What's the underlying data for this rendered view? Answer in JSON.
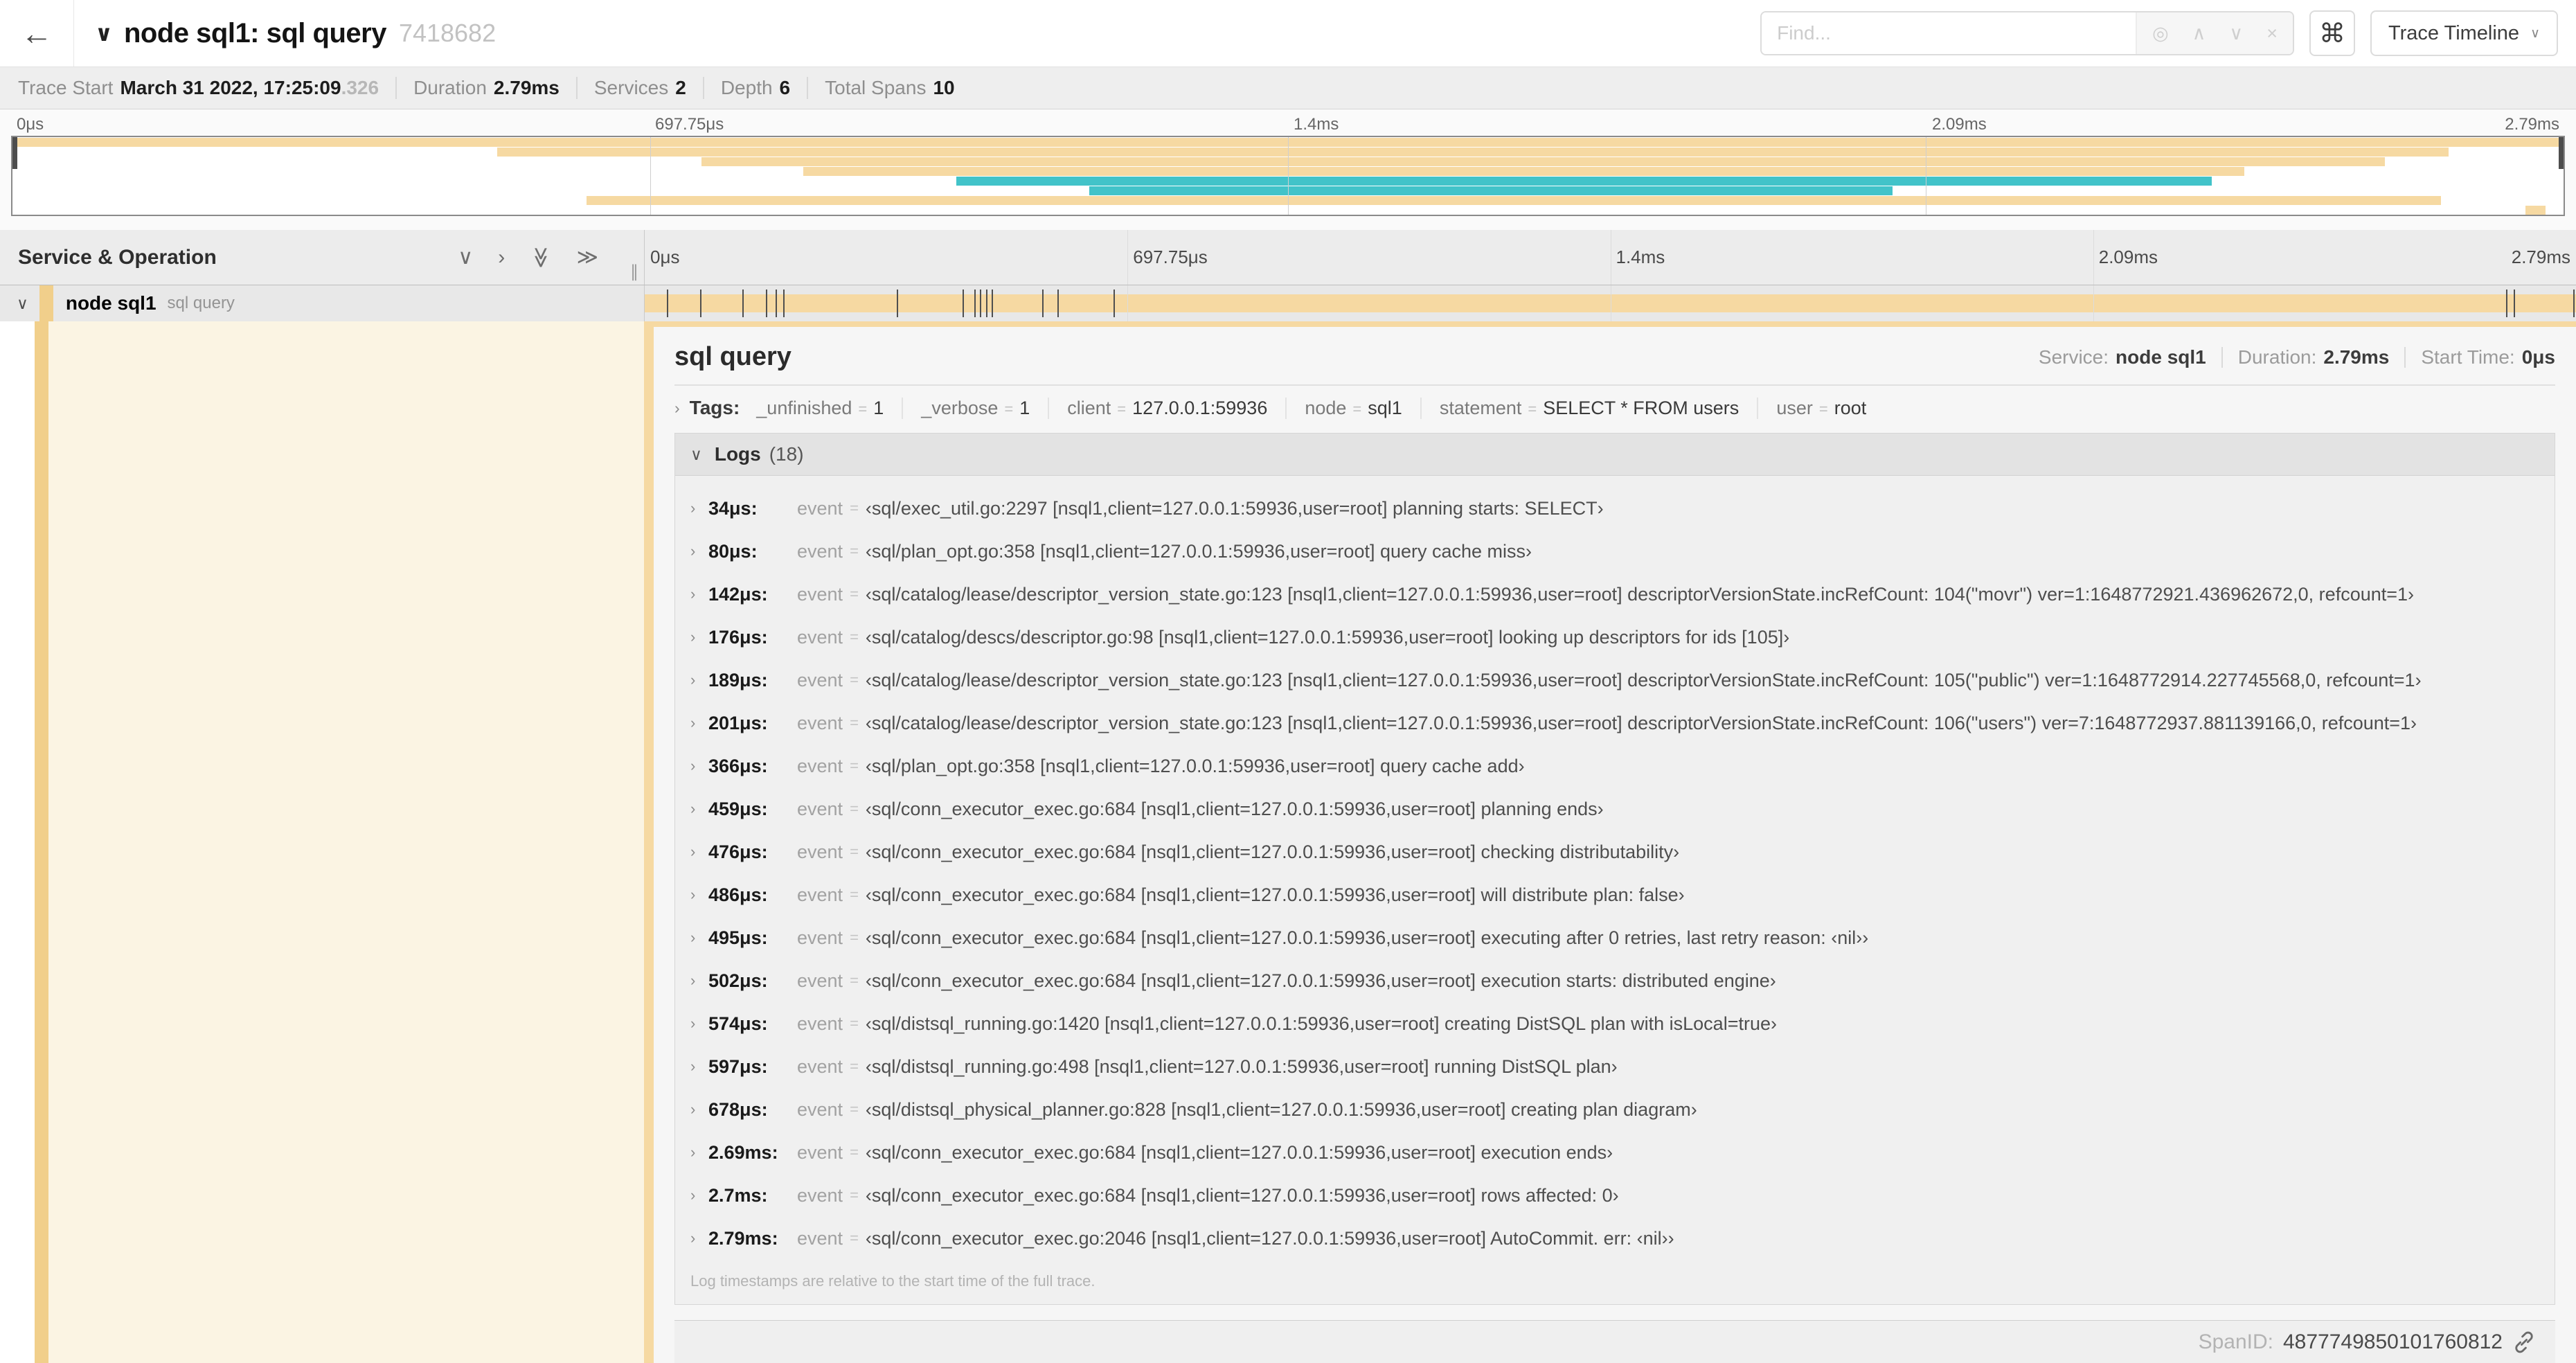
{
  "colors": {
    "yellow": "#f6d9a2",
    "teal": "#42c3c9",
    "accent": "#f1cf8b",
    "cream": "#fbf4e3",
    "tick": "#4f4f4f"
  },
  "icons": {
    "back": "←",
    "title_chevron": "∨",
    "find_locate": "◎",
    "find_prev": "∧",
    "find_next": "∨",
    "find_clear": "×",
    "keyboard": "⌘",
    "dropdown_chevron": "∨",
    "collapse_one": "∨",
    "expand_one": "›",
    "collapse_all": "≫",
    "expand_all": "≫",
    "row_chevron": "∨",
    "tags_chevron": "›",
    "logs_chevron": "∨",
    "log_chevron": "›",
    "resizer": "∥",
    "equals": "="
  },
  "header": {
    "title": "node sql1: sql query",
    "trace_id": "7418682",
    "find_placeholder": "Find...",
    "view_button": "Trace Timeline"
  },
  "trace_info": {
    "start_label": "Trace Start",
    "start_value": "March 31 2022, 17:25:09",
    "start_fraction": ".326",
    "duration_label": "Duration",
    "duration_value": "2.79ms",
    "services_label": "Services",
    "services_value": "2",
    "depth_label": "Depth",
    "depth_value": "6",
    "spans_label": "Total Spans",
    "spans_value": "10"
  },
  "timeline": {
    "ruler_ticks": [
      {
        "label": "0μs",
        "pos": 0
      },
      {
        "label": "697.75μs",
        "pos": 0.25
      },
      {
        "label": "1.4ms",
        "pos": 0.5
      },
      {
        "label": "2.09ms",
        "pos": 0.75
      },
      {
        "label": "2.79ms",
        "pos": 1
      }
    ],
    "gridlines": [
      0.25,
      0.5,
      0.75
    ],
    "minimap_spans": [
      {
        "start": 0,
        "end": 1,
        "color": "yellow"
      },
      {
        "start": 0.19,
        "end": 0.955,
        "color": "yellow"
      },
      {
        "start": 0.27,
        "end": 0.93,
        "color": "yellow"
      },
      {
        "start": 0.31,
        "end": 0.875,
        "color": "yellow"
      },
      {
        "start": 0.37,
        "end": 0.862,
        "color": "teal"
      },
      {
        "start": 0.422,
        "end": 0.737,
        "color": "teal"
      },
      {
        "start": 0.225,
        "end": 0.952,
        "color": "yellow"
      },
      {
        "start": 0.985,
        "end": 0.993,
        "color": "yellow"
      }
    ],
    "span_ticks": [
      0.012,
      0.029,
      0.051,
      0.063,
      0.068,
      0.072,
      0.131,
      0.165,
      0.171,
      0.174,
      0.177,
      0.18,
      0.206,
      0.214,
      0.243,
      0.964,
      0.968,
      0.999
    ]
  },
  "span_table": {
    "column_header": "Service & Operation",
    "row": {
      "service": "node sql1",
      "operation": "sql query"
    }
  },
  "detail": {
    "title": "sql query",
    "meta": {
      "service_label": "Service:",
      "service": "node sql1",
      "duration_label": "Duration:",
      "duration": "2.79ms",
      "start_label": "Start Time:",
      "start": "0μs"
    },
    "tags": {
      "label": "Tags:",
      "items": [
        {
          "key": "_unfinished",
          "value": "1"
        },
        {
          "key": "_verbose",
          "value": "1"
        },
        {
          "key": "client",
          "value": "127.0.0.1:59936"
        },
        {
          "key": "node",
          "value": "sql1"
        },
        {
          "key": "statement",
          "value": "SELECT * FROM users"
        },
        {
          "key": "user",
          "value": "root"
        }
      ]
    },
    "logs": {
      "label": "Logs",
      "count": "(18)",
      "field_key": "event",
      "entries": [
        {
          "time": "34μs:",
          "value": "‹sql/exec_util.go:2297 [nsql1,client=127.0.0.1:59936,user=root] planning starts: SELECT›"
        },
        {
          "time": "80μs:",
          "value": "‹sql/plan_opt.go:358 [nsql1,client=127.0.0.1:59936,user=root] query cache miss›"
        },
        {
          "time": "142μs:",
          "value": "‹sql/catalog/lease/descriptor_version_state.go:123 [nsql1,client=127.0.0.1:59936,user=root] descriptorVersionState.incRefCount: 104(\"movr\") ver=1:1648772921.436962672,0, refcount=1›"
        },
        {
          "time": "176μs:",
          "value": "‹sql/catalog/descs/descriptor.go:98 [nsql1,client=127.0.0.1:59936,user=root] looking up descriptors for ids [105]›"
        },
        {
          "time": "189μs:",
          "value": "‹sql/catalog/lease/descriptor_version_state.go:123 [nsql1,client=127.0.0.1:59936,user=root] descriptorVersionState.incRefCount: 105(\"public\") ver=1:1648772914.227745568,0, refcount=1›"
        },
        {
          "time": "201μs:",
          "value": "‹sql/catalog/lease/descriptor_version_state.go:123 [nsql1,client=127.0.0.1:59936,user=root] descriptorVersionState.incRefCount: 106(\"users\") ver=7:1648772937.881139166,0, refcount=1›"
        },
        {
          "time": "366μs:",
          "value": "‹sql/plan_opt.go:358 [nsql1,client=127.0.0.1:59936,user=root] query cache add›"
        },
        {
          "time": "459μs:",
          "value": "‹sql/conn_executor_exec.go:684 [nsql1,client=127.0.0.1:59936,user=root] planning ends›"
        },
        {
          "time": "476μs:",
          "value": "‹sql/conn_executor_exec.go:684 [nsql1,client=127.0.0.1:59936,user=root] checking distributability›"
        },
        {
          "time": "486μs:",
          "value": "‹sql/conn_executor_exec.go:684 [nsql1,client=127.0.0.1:59936,user=root] will distribute plan: false›"
        },
        {
          "time": "495μs:",
          "value": "‹sql/conn_executor_exec.go:684 [nsql1,client=127.0.0.1:59936,user=root] executing after 0 retries, last retry reason: ‹nil››"
        },
        {
          "time": "502μs:",
          "value": "‹sql/conn_executor_exec.go:684 [nsql1,client=127.0.0.1:59936,user=root] execution starts: distributed engine›"
        },
        {
          "time": "574μs:",
          "value": "‹sql/distsql_running.go:1420 [nsql1,client=127.0.0.1:59936,user=root] creating DistSQL plan with isLocal=true›"
        },
        {
          "time": "597μs:",
          "value": "‹sql/distsql_running.go:498 [nsql1,client=127.0.0.1:59936,user=root] running DistSQL plan›"
        },
        {
          "time": "678μs:",
          "value": "‹sql/distsql_physical_planner.go:828 [nsql1,client=127.0.0.1:59936,user=root] creating plan diagram›"
        },
        {
          "time": "2.69ms:",
          "value": "‹sql/conn_executor_exec.go:684 [nsql1,client=127.0.0.1:59936,user=root] execution ends›"
        },
        {
          "time": "2.7ms:",
          "value": "‹sql/conn_executor_exec.go:684 [nsql1,client=127.0.0.1:59936,user=root] rows affected: 0›"
        },
        {
          "time": "2.79ms:",
          "value": "‹sql/conn_executor_exec.go:2046 [nsql1,client=127.0.0.1:59936,user=root] AutoCommit. err: ‹nil››"
        }
      ],
      "footnote": "Log timestamps are relative to the start time of the full trace."
    },
    "span_id_label": "SpanID:",
    "span_id": "4877749850101760812"
  }
}
